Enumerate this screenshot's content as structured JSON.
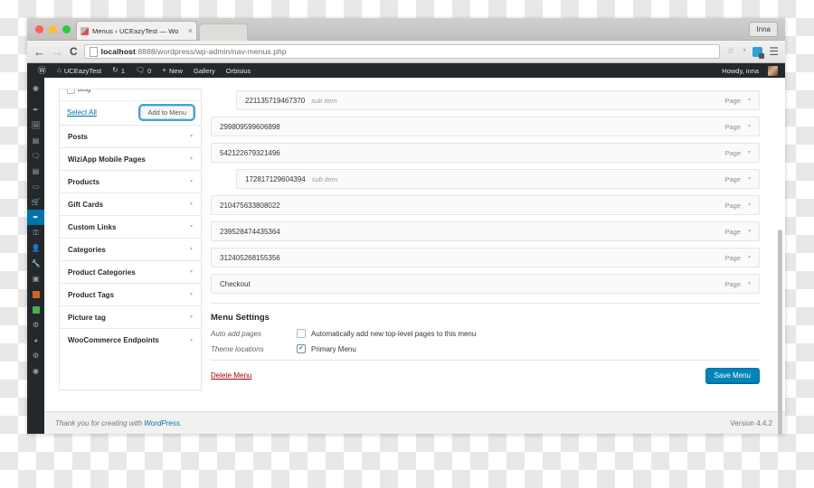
{
  "window": {
    "user_badge": "Inna",
    "tab": {
      "title": "Menus ‹ UCEazyTest — Wo",
      "close_icon": "×"
    },
    "toolbar": {
      "back_icon": "←",
      "forward_icon": "→",
      "reload_icon": "C",
      "url_host": "localhost",
      "url_rest": ":8888/wordpress/wp-admin/nav-menus.php",
      "star_icon": "☆",
      "clock_icon": "◔",
      "extension_icon": "extension-icon",
      "menu_icon": "☰"
    }
  },
  "adminbar": {
    "logo": "Ⓦ",
    "home_icon": "⌂",
    "site_name": "UCEazyTest",
    "updates_icon": "↻",
    "updates_count": "1",
    "comments_icon": "🗨",
    "comments_count": "0",
    "new_icon": "+",
    "new_label": "New",
    "gallery_label": "Gallery",
    "orbisius_label": "Orbisius",
    "howdy": "Howdy, inna"
  },
  "rail": {
    "items": [
      {
        "name": "dashboard",
        "glyph": "◉"
      },
      {
        "name": "posts",
        "glyph": "✒"
      },
      {
        "name": "media",
        "glyph": "🖼"
      },
      {
        "name": "pages",
        "glyph": "▤"
      },
      {
        "name": "comments",
        "glyph": "🗨"
      },
      {
        "name": "forms",
        "glyph": "▤"
      },
      {
        "name": "slider",
        "glyph": "▭"
      },
      {
        "name": "woocommerce",
        "glyph": "🛒"
      },
      {
        "name": "appearance",
        "glyph": "✒",
        "active": true
      },
      {
        "name": "plugins",
        "glyph": "⚿"
      },
      {
        "name": "users",
        "glyph": "👤"
      },
      {
        "name": "tools",
        "glyph": "🔧"
      },
      {
        "name": "settings-panel",
        "glyph": "▣"
      },
      {
        "name": "orange-plugin",
        "color": "#d2642a"
      },
      {
        "name": "green-plugin",
        "color": "#4caf50"
      },
      {
        "name": "gear-one",
        "glyph": "⚙"
      },
      {
        "name": "location",
        "glyph": "◕"
      },
      {
        "name": "gear-two",
        "glyph": "⚙"
      },
      {
        "name": "collapse",
        "glyph": "◉"
      }
    ]
  },
  "accordion": {
    "clipped_row_label": "blog",
    "select_all": "Select All",
    "add_to_menu": "Add to Menu",
    "rows": [
      {
        "label": "Posts"
      },
      {
        "label": "WiziApp Mobile Pages"
      },
      {
        "label": "Products"
      },
      {
        "label": "Gift Cards"
      },
      {
        "label": "Custom Links"
      },
      {
        "label": "Categories"
      },
      {
        "label": "Product Categories"
      },
      {
        "label": "Product Tags"
      },
      {
        "label": "Picture tag"
      },
      {
        "label": "WooCommerce Endpoints"
      }
    ],
    "arrow_icon": "▾"
  },
  "structure": {
    "caret_icon": "▾",
    "items": [
      {
        "title": "221135719467370",
        "sub": "sub item",
        "type": "Page",
        "indent": true
      },
      {
        "title": "299809599606898",
        "sub": "",
        "type": "Page",
        "indent": false
      },
      {
        "title": "542122679321496",
        "sub": "",
        "type": "Page",
        "indent": false
      },
      {
        "title": "172817129604394",
        "sub": "sub item",
        "type": "Page",
        "indent": true
      },
      {
        "title": "210475633808022",
        "sub": "",
        "type": "Page",
        "indent": false
      },
      {
        "title": "239528474435364",
        "sub": "",
        "type": "Page",
        "indent": false
      },
      {
        "title": "312405268155356",
        "sub": "",
        "type": "Page",
        "indent": false
      },
      {
        "title": "Checkout",
        "sub": "",
        "type": "Page",
        "indent": false
      }
    ]
  },
  "settings": {
    "heading": "Menu Settings",
    "auto_add_label": "Auto add pages",
    "auto_add_text": "Automatically add new top-level pages to this menu",
    "auto_add_checked": false,
    "theme_locations_label": "Theme locations",
    "primary_menu_text": "Primary Menu",
    "primary_menu_checked": true,
    "check_mark": "✔"
  },
  "actions": {
    "delete_menu": "Delete Menu",
    "save_menu": "Save Menu"
  },
  "footer": {
    "thanks_prefix": "Thank you for creating with ",
    "wordpress_link": "WordPress",
    "thanks_suffix": ".",
    "version": "Version 4.4.2"
  },
  "colors": {
    "admin_dark": "#23282d",
    "accent_blue": "#0073aa",
    "save_blue": "#0085ba",
    "delete_red": "#a00",
    "focus_ring": "#3ea2e0"
  }
}
